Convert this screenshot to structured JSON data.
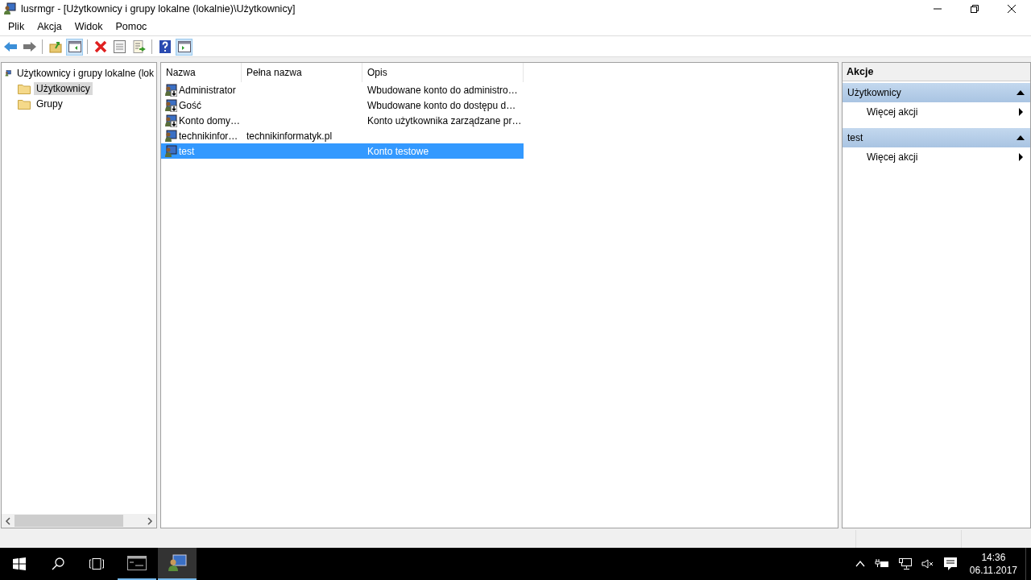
{
  "window": {
    "title": "lusrmgr - [Użytkownicy i grupy lokalne (lokalnie)\\Użytkownicy]"
  },
  "menu": [
    "Plik",
    "Akcja",
    "Widok",
    "Pomoc"
  ],
  "toolbar": [
    {
      "kind": "back",
      "on": false
    },
    {
      "kind": "forward",
      "on": false
    },
    {
      "kind": "sep"
    },
    {
      "kind": "up",
      "on": false
    },
    {
      "kind": "tree",
      "on": true
    },
    {
      "kind": "sep"
    },
    {
      "kind": "delete",
      "on": false
    },
    {
      "kind": "properties",
      "on": false
    },
    {
      "kind": "export",
      "on": false
    },
    {
      "kind": "sep"
    },
    {
      "kind": "help",
      "on": false
    },
    {
      "kind": "pane",
      "on": true
    }
  ],
  "tree": [
    {
      "label": "Użytkownicy i grupy lokalne (lok",
      "kind": "computer",
      "selected": false,
      "children": [
        {
          "label": "Użytkownicy",
          "kind": "folder",
          "selected": true
        },
        {
          "label": "Grupy",
          "kind": "folder",
          "selected": false
        }
      ]
    }
  ],
  "table": {
    "columns": [
      "Nazwa",
      "Pełna nazwa",
      "Opis"
    ],
    "rows": [
      {
        "cells": [
          "Administrator",
          "",
          "Wbudowane konto do administro…"
        ],
        "disabled": true,
        "selected": false
      },
      {
        "cells": [
          "Gość",
          "",
          "Wbudowane konto do dostępu d…"
        ],
        "disabled": true,
        "selected": false
      },
      {
        "cells": [
          "Konto domy…",
          "",
          "Konto użytkownika zarządzane pr…"
        ],
        "disabled": true,
        "selected": false
      },
      {
        "cells": [
          "technikinfor…",
          "technikinformatyk.pl",
          ""
        ],
        "disabled": false,
        "selected": false
      },
      {
        "cells": [
          "test",
          "",
          "Konto testowe"
        ],
        "disabled": false,
        "selected": true
      }
    ]
  },
  "actions": {
    "title": "Akcje",
    "groups": [
      {
        "title": "Użytkownicy",
        "expanded": true,
        "items": [
          "Więcej akcji"
        ]
      },
      {
        "title": "test",
        "expanded": true,
        "items": [
          "Więcej akcji"
        ]
      }
    ]
  },
  "taskbar": {
    "apps": [
      {
        "kind": "console",
        "selected": false
      },
      {
        "kind": "users",
        "selected": true
      }
    ],
    "time": "14:36",
    "date": "06.11.2017"
  }
}
